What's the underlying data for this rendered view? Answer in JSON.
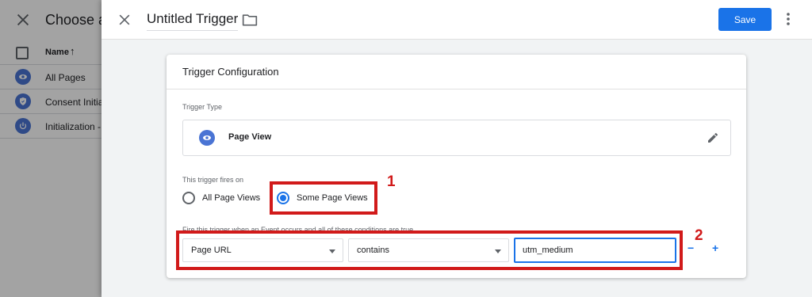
{
  "background": {
    "title": "Choose a",
    "column_name": "Name",
    "sort_arrow": "↑",
    "rows": [
      {
        "label": "All Pages",
        "icon": "eye-icon"
      },
      {
        "label": "Consent Initia",
        "icon": "shield-icon"
      },
      {
        "label": "Initialization -",
        "icon": "power-icon"
      }
    ]
  },
  "header": {
    "trigger_name": "Untitled Trigger",
    "save_label": "Save"
  },
  "card": {
    "title": "Trigger Configuration",
    "trigger_type_label": "Trigger Type",
    "trigger_type_name": "Page View",
    "fires_on_label": "This trigger fires on",
    "options": {
      "all": "All Page Views",
      "some": "Some Page Views"
    },
    "selected_option": "some",
    "condition_label": "Fire this trigger when an Event occurs and all of these conditions are true",
    "condition": {
      "variable": "Page URL",
      "operator": "contains",
      "value": "utm_medium"
    },
    "minus_label": "−",
    "plus_label": "+"
  },
  "annotations": {
    "one": "1",
    "two": "2"
  },
  "colors": {
    "accent": "#1a73e8",
    "annotation": "#d11a1a",
    "icon_blue": "#4a74d4"
  }
}
